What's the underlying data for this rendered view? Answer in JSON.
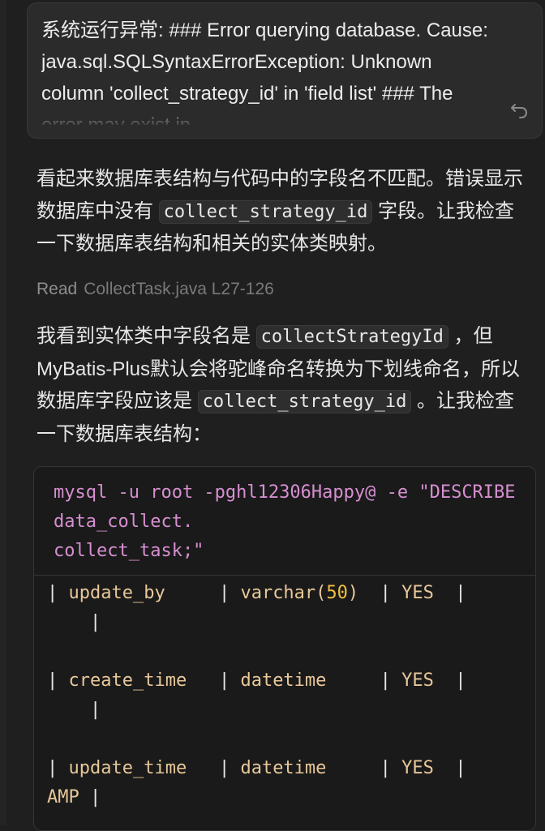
{
  "user_message": {
    "text": "系统运行异常: ### Error querying database. Cause: java.sql.SQLSyntaxErrorException: Unknown column 'collect_strategy_id' in 'field list' ### The error may exist in"
  },
  "assistant": {
    "para1": {
      "before": "看起来数据库表结构与代码中的字段名不匹配。错误显示数据库中没有",
      "code": "collect_strategy_id",
      "after": "字段。让我检查一下数据库表结构和相关的实体类映射。"
    },
    "read_action": {
      "verb": "Read",
      "target": "CollectTask.java L27-126"
    },
    "para2": {
      "before": "我看到实体类中字段名是",
      "code1": "collectStrategyId",
      "middle": "，但MyBatis-Plus默认会将驼峰命名转换为下划线命名，所以数据库字段应该是",
      "code2": "collect_strategy_id",
      "after": "。让我检查一下数据库表结构："
    },
    "code_block": {
      "command": "mysql -u root -pghl12306Happy@ -e \"DESCRIBE data_collect.\ncollect_task;\"",
      "rows": [
        {
          "field": "update_by",
          "type_pre": "varchar(",
          "type_num": "50",
          "type_post": ")",
          "null": "YES"
        },
        {
          "field": "create_time",
          "type_pre": "datetime",
          "type_num": "",
          "type_post": "",
          "null": "YES"
        },
        {
          "field": "update_time",
          "type_pre": "datetime",
          "type_num": "",
          "type_post": "",
          "null": "YES"
        }
      ],
      "tail_fragment": "AMP"
    }
  },
  "icons": {
    "undo": "undo-icon"
  }
}
